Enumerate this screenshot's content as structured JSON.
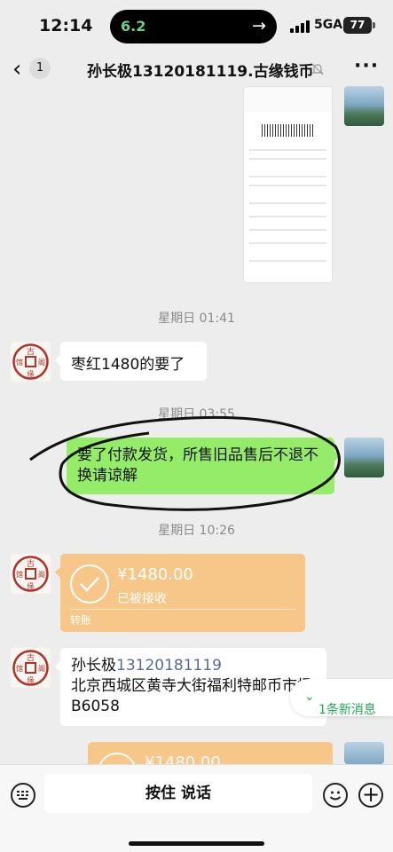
{
  "status": {
    "time": "12:14",
    "speed": "6.2",
    "network": "5GA",
    "battery": "77"
  },
  "nav": {
    "back_count": "1",
    "title": "孙长极13120181119.古缘钱币"
  },
  "messages": {
    "ts1": "星期日 01:41",
    "msg1": "枣红1480的要了",
    "ts2": "星期日 03:55",
    "msg2": "要了付款发货，所售旧品售后不退不换请谅解",
    "ts3": "星期日 10:26",
    "transfer1": {
      "amount": "¥1480.00",
      "status": "已被接收",
      "kind": "转账"
    },
    "address_name": "孙长极",
    "address_phone": "13120181119",
    "address_line": "北京西城区黄寺大街福利特邮币市场B6058",
    "transfer2": {
      "amount": "¥1480.00"
    }
  },
  "new_messages": "1条新消息",
  "input": {
    "voice_label": "按住 说话"
  },
  "colors": {
    "bubble_green": "#95ec69",
    "transfer": "#f7c689",
    "new_msg": "#1fa855"
  },
  "icons": [
    "back-arrow-icon",
    "mute-icon",
    "more-icon",
    "keyboard-icon",
    "emoji-icon",
    "plus-icon",
    "check-icon"
  ]
}
